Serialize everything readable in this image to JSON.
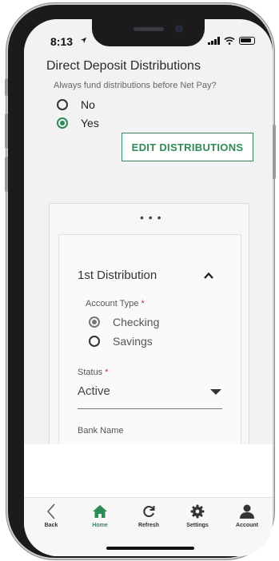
{
  "status_bar": {
    "time": "8:13"
  },
  "section": {
    "title": "Direct Deposit Distributions",
    "question": "Always fund distributions before Net Pay?",
    "options": [
      {
        "label": "No",
        "selected": false
      },
      {
        "label": "Yes",
        "selected": true
      }
    ],
    "edit_button": "EDIT DISTRIBUTIONS"
  },
  "distribution": {
    "title": "1st Distribution",
    "account_type_label": "Account Type",
    "required_mark": "*",
    "account_types": [
      {
        "label": "Checking",
        "selected": true
      },
      {
        "label": "Savings",
        "selected": false
      }
    ],
    "status_label": "Status",
    "status_value": "Active",
    "bank_name_label": "Bank Name"
  },
  "tab_bar": {
    "tabs": [
      {
        "label": "Back",
        "icon": "back-chevron-icon",
        "active": false
      },
      {
        "label": "Home",
        "icon": "home-icon",
        "active": true
      },
      {
        "label": "Refresh",
        "icon": "refresh-icon",
        "active": false
      },
      {
        "label": "Settings",
        "icon": "gear-icon",
        "active": false
      },
      {
        "label": "Account",
        "icon": "person-icon",
        "active": false
      }
    ]
  },
  "colors": {
    "accent": "#2e8b57",
    "required": "#d32f2f"
  }
}
